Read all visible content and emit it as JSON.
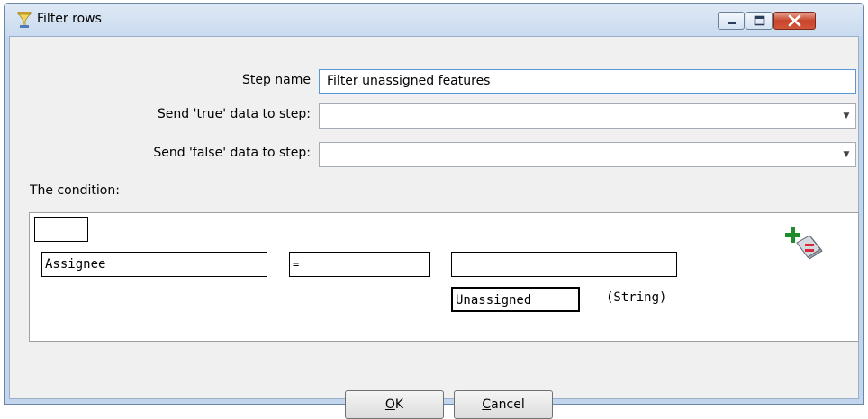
{
  "window": {
    "title": "Filter rows"
  },
  "form": {
    "step_name_label": "Step name",
    "step_name_value": "Filter unassigned features",
    "true_label": "Send 'true' data to step:",
    "true_value": "",
    "false_label": "Send 'false' data to step:",
    "false_value": ""
  },
  "condition": {
    "section_label": "The condition:",
    "negate_value": "",
    "left_field": "Assignee",
    "operator": "=",
    "right_field": "",
    "constant_value": "Unassigned",
    "constant_type": "(String)"
  },
  "buttons": {
    "ok_mnemonic": "O",
    "ok_rest": "K",
    "cancel_mnemonic": "C",
    "cancel_rest": "ancel"
  },
  "icons": {
    "app": "filter-funnel-icon",
    "add_condition": "add-condition-icon"
  },
  "colors": {
    "title_bg": "#c9dbef",
    "close_button": "#c8452c",
    "dialog_bg": "#f0f0f0"
  }
}
